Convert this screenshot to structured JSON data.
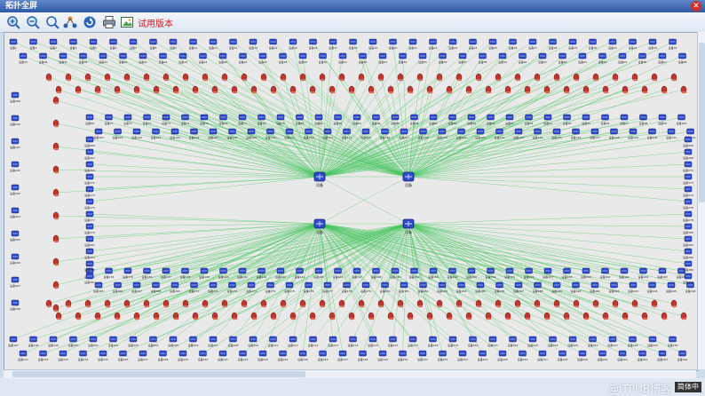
{
  "window": {
    "title": "拓扑全屏"
  },
  "toolbar": {
    "trial_label": "试用版本",
    "buttons": [
      "zoom-in",
      "zoom-out",
      "zoom-fit",
      "layout",
      "refresh",
      "print",
      "export"
    ]
  },
  "topology": {
    "core_label": "设备",
    "node_label_prefix": "设备",
    "colors": {
      "link": "#42c55a",
      "switch": "#2f49c8",
      "router": "#c0352d",
      "background": "#e9e9e9"
    }
  },
  "status": {
    "watermark": "@ITPUB博客",
    "badge": "简体中"
  }
}
